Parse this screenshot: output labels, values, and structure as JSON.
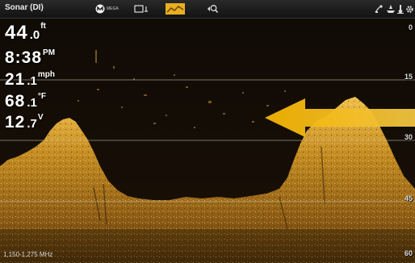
{
  "topbar": {
    "title": "Sonar (DI)",
    "mega_label": "MEGA"
  },
  "readouts": {
    "depth": {
      "whole": "44",
      "decimal": ".0",
      "unit": "ft"
    },
    "time": {
      "value": "8:38",
      "unit": "PM"
    },
    "speed": {
      "whole": "21",
      "decimal": ".1",
      "unit": "mph"
    },
    "temperature": {
      "whole": "68",
      "decimal": ".1",
      "unit": "°F"
    },
    "voltage": {
      "whole": "12",
      "decimal": ".7",
      "unit": "V"
    }
  },
  "depth_scale": {
    "labels": [
      "0",
      "15",
      "30",
      "45",
      "60"
    ]
  },
  "frequency": "1,150-1,275 MHz",
  "colors": {
    "accent": "#f2b71c",
    "sonar_bright": "#e8b23a",
    "sonar_dark": "#5a3c10",
    "background": "#0c0905"
  },
  "icons": {
    "mega": "mega-icon",
    "chart_view": "chart-view-icon",
    "sonar_view": "sonar-view-icon",
    "zoom": "zoom-icon",
    "gps": "gps-icon",
    "boat": "boat-icon",
    "temp": "temperature-icon",
    "settings": "gear-icon"
  }
}
